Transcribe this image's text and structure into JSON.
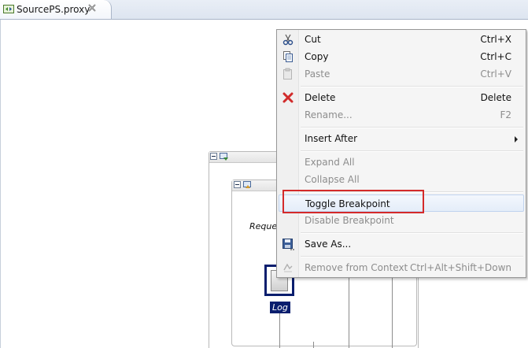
{
  "editor_tab": {
    "title": "SourcePS.proxy"
  },
  "diagram": {
    "request_label": "Reques",
    "log_label": "Log"
  },
  "context_menu": {
    "items": [
      {
        "label": "Cut",
        "shortcut": "Ctrl+X",
        "icon": "scissors-icon",
        "enabled": true
      },
      {
        "label": "Copy",
        "shortcut": "Ctrl+C",
        "icon": "copy-icon",
        "enabled": true
      },
      {
        "label": "Paste",
        "shortcut": "Ctrl+V",
        "icon": "paste-icon",
        "enabled": false
      },
      {
        "label": "Delete",
        "shortcut": "Delete",
        "icon": "delete-icon",
        "enabled": true
      },
      {
        "label": "Rename...",
        "shortcut": "F2",
        "enabled": false
      },
      {
        "label": "Insert After",
        "submenu": true,
        "enabled": true
      },
      {
        "label": "Expand All",
        "enabled": false
      },
      {
        "label": "Collapse All",
        "enabled": false
      },
      {
        "label": "Toggle Breakpoint",
        "enabled": true,
        "highlighted": true
      },
      {
        "label": "Disable Breakpoint",
        "enabled": false
      },
      {
        "label": "Save As...",
        "icon": "save-icon",
        "enabled": true
      },
      {
        "label": "Remove from Context",
        "shortcut": "Ctrl+Alt+Shift+Down",
        "icon": "remove-context-icon",
        "enabled": false
      }
    ]
  },
  "colors": {
    "highlight_annotation": "#d42a2a",
    "selection_blue": "#0a1e6e",
    "delete_red": "#d12b2b"
  }
}
